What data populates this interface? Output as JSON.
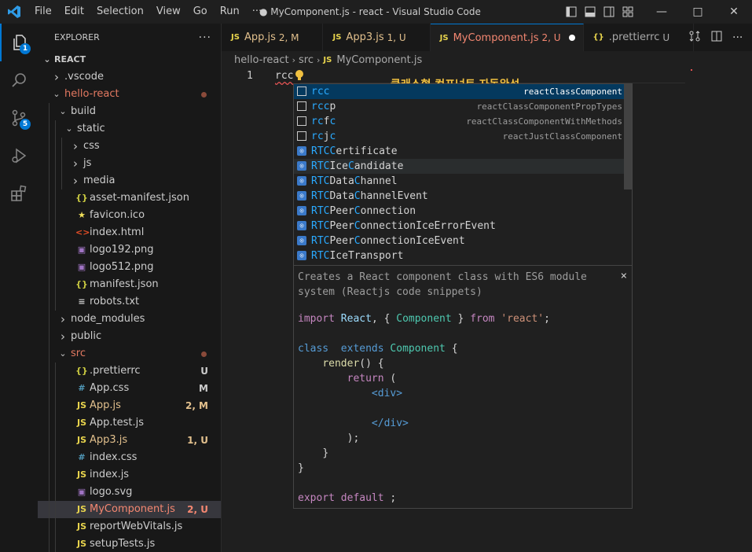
{
  "titlebar": {
    "menu": [
      "File",
      "Edit",
      "Selection",
      "View",
      "Go",
      "Run",
      "···"
    ],
    "title": "● MyComponent.js - react - Visual Studio Code",
    "window_controls": [
      "minimize-icon",
      "maximize-icon",
      "close-icon"
    ]
  },
  "activity": {
    "explorer_badge": "1",
    "scm_badge": "5"
  },
  "explorer": {
    "title": "EXPLORER",
    "more": "···",
    "root": "REACT",
    "items": [
      {
        "label": ".vscode",
        "type": "folder",
        "open": false,
        "depth": 1,
        "color": "#cccccc"
      },
      {
        "label": "hello-react",
        "type": "folder",
        "open": true,
        "depth": 1,
        "color": "#e37961",
        "dot": true
      },
      {
        "label": "build",
        "type": "folder",
        "open": true,
        "depth": 2,
        "color": "#cccccc"
      },
      {
        "label": "static",
        "type": "folder",
        "open": true,
        "depth": 3,
        "color": "#cccccc"
      },
      {
        "label": "css",
        "type": "folder",
        "open": false,
        "depth": 4,
        "color": "#cccccc"
      },
      {
        "label": "js",
        "type": "folder",
        "open": false,
        "depth": 4,
        "color": "#cccccc"
      },
      {
        "label": "media",
        "type": "folder",
        "open": false,
        "depth": 4,
        "color": "#cccccc"
      },
      {
        "label": "asset-manifest.json",
        "type": "file",
        "icon": "{}",
        "icon_color": "#cbcb41",
        "depth": 3,
        "color": "#cccccc"
      },
      {
        "label": "favicon.ico",
        "type": "file",
        "icon": "★",
        "icon_color": "#f1e05a",
        "depth": 3,
        "color": "#cccccc"
      },
      {
        "label": "index.html",
        "type": "file",
        "icon": "<>",
        "icon_color": "#e44d26",
        "depth": 3,
        "color": "#cccccc"
      },
      {
        "label": "logo192.png",
        "type": "file",
        "icon": "▣",
        "icon_color": "#a074c4",
        "depth": 3,
        "color": "#cccccc"
      },
      {
        "label": "logo512.png",
        "type": "file",
        "icon": "▣",
        "icon_color": "#a074c4",
        "depth": 3,
        "color": "#cccccc"
      },
      {
        "label": "manifest.json",
        "type": "file",
        "icon": "{}",
        "icon_color": "#cbcb41",
        "depth": 3,
        "color": "#cccccc"
      },
      {
        "label": "robots.txt",
        "type": "file",
        "icon": "≡",
        "icon_color": "#cccccc",
        "depth": 3,
        "color": "#cccccc"
      },
      {
        "label": "node_modules",
        "type": "folder",
        "open": false,
        "depth": 2,
        "color": "#cccccc"
      },
      {
        "label": "public",
        "type": "folder",
        "open": false,
        "depth": 2,
        "color": "#cccccc"
      },
      {
        "label": "src",
        "type": "folder",
        "open": true,
        "depth": 2,
        "color": "#e37961",
        "dot": true
      },
      {
        "label": ".prettierrc",
        "type": "file",
        "icon": "{}",
        "icon_color": "#cbcb41",
        "depth": 3,
        "color": "#cccccc",
        "badge": "U",
        "badge_color": "#cccccc"
      },
      {
        "label": "App.css",
        "type": "file",
        "icon": "#",
        "icon_color": "#519aba",
        "depth": 3,
        "color": "#cccccc",
        "badge": "M",
        "badge_color": "#cccccc"
      },
      {
        "label": "App.js",
        "type": "file",
        "icon": "JS",
        "icon_color": "#e8d44d",
        "depth": 3,
        "color": "#e2c08d",
        "badge": "2, M",
        "badge_color": "#e2c08d"
      },
      {
        "label": "App.test.js",
        "type": "file",
        "icon": "JS",
        "icon_color": "#e8d44d",
        "depth": 3,
        "color": "#cccccc"
      },
      {
        "label": "App3.js",
        "type": "file",
        "icon": "JS",
        "icon_color": "#e8d44d",
        "depth": 3,
        "color": "#e2c08d",
        "badge": "1, U",
        "badge_color": "#e2c08d"
      },
      {
        "label": "index.css",
        "type": "file",
        "icon": "#",
        "icon_color": "#519aba",
        "depth": 3,
        "color": "#cccccc"
      },
      {
        "label": "index.js",
        "type": "file",
        "icon": "JS",
        "icon_color": "#e8d44d",
        "depth": 3,
        "color": "#cccccc"
      },
      {
        "label": "logo.svg",
        "type": "file",
        "icon": "▣",
        "icon_color": "#a074c4",
        "depth": 3,
        "color": "#cccccc"
      },
      {
        "label": "MyComponent.js",
        "type": "file",
        "icon": "JS",
        "icon_color": "#e8d44d",
        "depth": 3,
        "color": "#f48771",
        "badge": "2, U",
        "badge_color": "#f48771",
        "selected": true
      },
      {
        "label": "reportWebVitals.js",
        "type": "file",
        "icon": "JS",
        "icon_color": "#e8d44d",
        "depth": 3,
        "color": "#cccccc"
      },
      {
        "label": "setupTests.js",
        "type": "file",
        "icon": "JS",
        "icon_color": "#e8d44d",
        "depth": 3,
        "color": "#cccccc"
      }
    ]
  },
  "tabs": [
    {
      "icon": "JS",
      "label": "App.js",
      "status": "2, M",
      "color": "#e2c08d",
      "active": false
    },
    {
      "icon": "JS",
      "label": "App3.js",
      "status": "1, U",
      "color": "#e2c08d",
      "active": false
    },
    {
      "icon": "JS",
      "label": "MyComponent.js",
      "status": "2, U",
      "color": "#f48771",
      "active": true,
      "dirty": true
    },
    {
      "icon": "{}",
      "label": ".prettierrc",
      "status": "U",
      "color": "#a9a9a9",
      "active": false
    }
  ],
  "breadcrumb": [
    "hello-react",
    "src",
    "MyComponent.js"
  ],
  "editor": {
    "line_number": "1",
    "code": "rcc",
    "annotation": "클래스형 컴포넌트 자동완성"
  },
  "suggest": {
    "items": [
      {
        "kind": "snippet",
        "match": "rcc",
        "rest": "",
        "detail": "reactClassComponent",
        "selected": true
      },
      {
        "kind": "snippet",
        "match": "rcc",
        "rest": "p",
        "detail": "reactClassComponentPropTypes"
      },
      {
        "kind": "snippet",
        "parts": [
          [
            "rc",
            true
          ],
          [
            "f",
            false
          ],
          [
            "c",
            true
          ]
        ],
        "detail": "reactClassComponentWithMethods"
      },
      {
        "kind": "snippet",
        "parts": [
          [
            "rc",
            true
          ],
          [
            "j",
            false
          ],
          [
            "c",
            true
          ]
        ],
        "detail": "reactJustClassComponent"
      },
      {
        "kind": "class",
        "parts": [
          [
            "RTCC",
            true
          ],
          [
            "ertificate",
            false
          ]
        ],
        "detail": ""
      },
      {
        "kind": "class",
        "parts": [
          [
            "RTC",
            true
          ],
          [
            "Ice",
            false
          ],
          [
            "C",
            true
          ],
          [
            "andidate",
            false
          ]
        ],
        "detail": "",
        "hover": true
      },
      {
        "kind": "class",
        "parts": [
          [
            "RTC",
            true
          ],
          [
            "Data",
            false
          ],
          [
            "C",
            true
          ],
          [
            "hannel",
            false
          ]
        ],
        "detail": ""
      },
      {
        "kind": "class",
        "parts": [
          [
            "RTC",
            true
          ],
          [
            "Data",
            false
          ],
          [
            "C",
            true
          ],
          [
            "hannelEvent",
            false
          ]
        ],
        "detail": ""
      },
      {
        "kind": "class",
        "parts": [
          [
            "RTC",
            true
          ],
          [
            "Peer",
            false
          ],
          [
            "C",
            true
          ],
          [
            "onnection",
            false
          ]
        ],
        "detail": ""
      },
      {
        "kind": "class",
        "parts": [
          [
            "RTC",
            true
          ],
          [
            "Peer",
            false
          ],
          [
            "C",
            true
          ],
          [
            "onnectionIceErrorEvent",
            false
          ]
        ],
        "detail": ""
      },
      {
        "kind": "class",
        "parts": [
          [
            "RTC",
            true
          ],
          [
            "Peer",
            false
          ],
          [
            "C",
            true
          ],
          [
            "onnectionIceEvent",
            false
          ]
        ],
        "detail": ""
      },
      {
        "kind": "class",
        "parts": [
          [
            "RTC",
            true
          ],
          [
            "IceTransport",
            false
          ]
        ],
        "detail": ""
      }
    ],
    "doc_description": "Creates a React component class with ES6 module system (Reactjs code snippets)",
    "doc_close": "×",
    "doc_code": {
      "import_kw": "import",
      "react": "React",
      "comma_brace": ", {",
      "component": "Component",
      "close_brace": "}",
      "from_kw": "from",
      "react_str": "'react'",
      "semi": ";",
      "class_kw": "class",
      "extends_kw": "extends",
      "component2": "Component",
      "open_brace": "{",
      "render": "render",
      "render_rest": "() {",
      "return_kw": "return",
      "paren_open": "(",
      "div_open": "<div>",
      "div_close": "</div>",
      "paren_close": ");",
      "brace_close": "}",
      "brace_close2": "}",
      "export_kw": "export",
      "default_kw": "default",
      "export_rest": ";"
    }
  }
}
